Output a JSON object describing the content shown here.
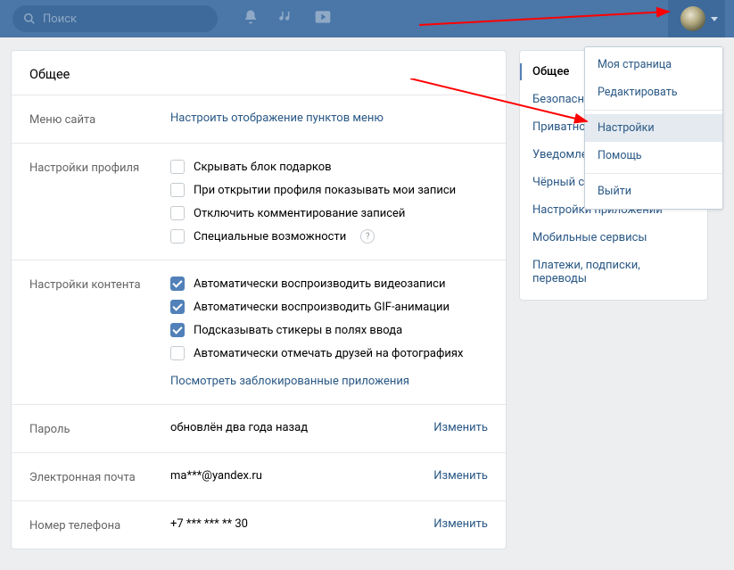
{
  "topbar": {
    "search_placeholder": "Поиск"
  },
  "dropdown": {
    "my_page": "Моя страница",
    "edit": "Редактировать",
    "settings": "Настройки",
    "help": "Помощь",
    "logout": "Выйти"
  },
  "main": {
    "title": "Общее",
    "menu_row": {
      "label": "Меню сайта",
      "link": "Настроить отображение пунктов меню"
    },
    "profile": {
      "label": "Настройки профиля",
      "hide_gifts": "Скрывать блок подарков",
      "show_my_posts": "При открытии профиля показывать мои записи",
      "disable_comments": "Отключить комментирование записей",
      "accessibility": "Специальные возможности"
    },
    "content": {
      "label": "Настройки контента",
      "auto_video": "Автоматически воспроизводить видеозаписи",
      "auto_gif": "Автоматически воспроизводить GIF-анимации",
      "stickers_hint": "Подсказывать стикеры в полях ввода",
      "auto_tag": "Автоматически отмечать друзей на фотографиях",
      "blocked_apps": "Посмотреть заблокированные приложения"
    },
    "password": {
      "label": "Пароль",
      "value": "обновлён два года назад",
      "change": "Изменить"
    },
    "email": {
      "label": "Электронная почта",
      "value": "ma***@yandex.ru",
      "change": "Изменить"
    },
    "phone": {
      "label": "Номер телефона",
      "value": "+7 *** *** ** 30",
      "change": "Изменить"
    }
  },
  "sidebar": {
    "items": [
      "Общее",
      "Безопасность",
      "Приватность",
      "Уведомления",
      "Чёрный список",
      "Настройки приложений",
      "Мобильные сервисы",
      "Платежи, подписки, переводы"
    ]
  }
}
